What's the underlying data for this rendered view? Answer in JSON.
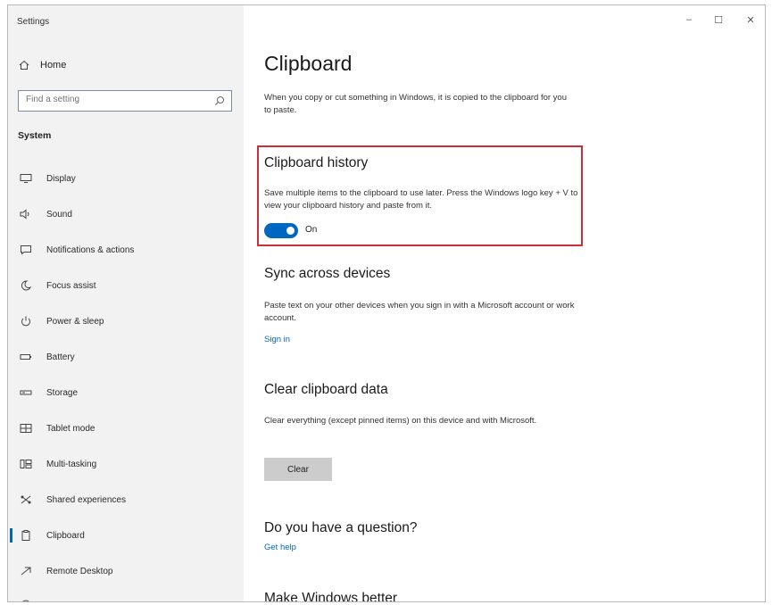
{
  "window": {
    "title": "Settings",
    "minimize": "–",
    "maximize": "☐",
    "close": "✕"
  },
  "sidebar": {
    "home_label": "Home",
    "search_placeholder": "Find a setting",
    "section_label": "System",
    "items": [
      {
        "label": "Display",
        "icon": "display-icon"
      },
      {
        "label": "Sound",
        "icon": "sound-icon"
      },
      {
        "label": "Notifications & actions",
        "icon": "notifications-icon"
      },
      {
        "label": "Focus assist",
        "icon": "focus-assist-icon"
      },
      {
        "label": "Power & sleep",
        "icon": "power-icon"
      },
      {
        "label": "Battery",
        "icon": "battery-icon"
      },
      {
        "label": "Storage",
        "icon": "storage-icon"
      },
      {
        "label": "Tablet mode",
        "icon": "tablet-mode-icon"
      },
      {
        "label": "Multi-tasking",
        "icon": "multitasking-icon"
      },
      {
        "label": "Shared experiences",
        "icon": "shared-experiences-icon"
      },
      {
        "label": "Clipboard",
        "icon": "clipboard-icon",
        "selected": true
      },
      {
        "label": "Remote Desktop",
        "icon": "remote-desktop-icon"
      }
    ]
  },
  "main": {
    "title": "Clipboard",
    "intro": "When you copy or cut something in Windows, it is copied to the clipboard for you to paste.",
    "history": {
      "heading": "Clipboard history",
      "description": "Save multiple items to the clipboard to use later. Press the Windows logo key + V to view your clipboard history and paste from it.",
      "toggle_state": "On"
    },
    "sync": {
      "heading": "Sync across devices",
      "description": "Paste text on your other devices when you sign in with a Microsoft account or work account.",
      "link": "Sign in"
    },
    "clear": {
      "heading": "Clear clipboard data",
      "description": "Clear everything (except pinned items) on this device and with Microsoft.",
      "button": "Clear"
    },
    "question": {
      "heading": "Do you have a question?",
      "link": "Get help"
    },
    "better": {
      "heading": "Make Windows better"
    }
  },
  "colors": {
    "accent": "#0067c0",
    "highlight_border": "#cc2f3a",
    "sidebar_bg": "#f2f2f2"
  }
}
